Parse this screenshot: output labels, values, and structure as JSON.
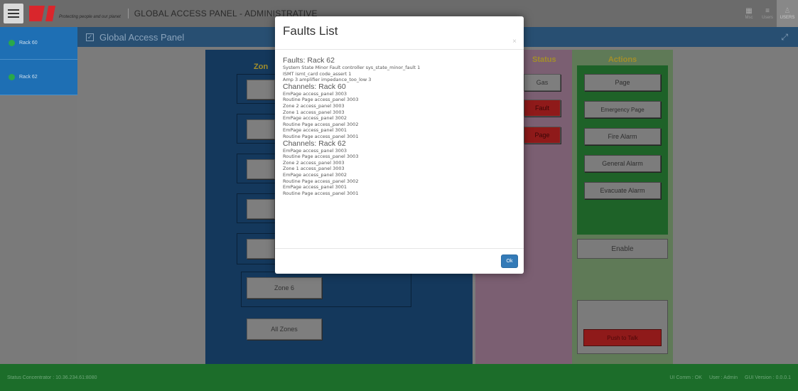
{
  "header": {
    "logo_tagline": "Protecting people and our planet",
    "app_title": "GLOBAL ACCESS PANEL - ADMINISTRATIVE",
    "buttons": [
      {
        "label": "Msc",
        "icon": "grid-icon"
      },
      {
        "label": "Users",
        "icon": "list-icon"
      },
      {
        "label": "USERS",
        "icon": "user-icon"
      }
    ]
  },
  "sidebar": {
    "items": [
      {
        "label": "Rack 60",
        "status_color": "#2aa84a"
      },
      {
        "label": "Rack 62",
        "status_color": "#2aa84a"
      }
    ]
  },
  "panel": {
    "title": "Global Access Panel"
  },
  "zones": {
    "title_partial": "Zon",
    "buttons": [
      "Zone 6",
      "All Zones"
    ]
  },
  "status": {
    "title": "Status",
    "buttons": [
      {
        "label": "Gas",
        "color": "#7e7e7e"
      },
      {
        "label": "Fault",
        "color": "#8f1a1a"
      },
      {
        "label": "Page",
        "color": "#8f1a1a"
      }
    ]
  },
  "actions": {
    "title": "Actions",
    "buttons": [
      "Page",
      "Emergency Page",
      "Fire Alarm",
      "General Alarm",
      "Evacuate Alarm"
    ],
    "enable_label": "Enable",
    "push_to_talk_label": "Push to Talk"
  },
  "statusbar": {
    "left": "Status Concentrator : 10.36.234.61:8080",
    "ui_comm": "UI Comm : OK",
    "user": "User : Admin",
    "gui_version": "GUI Version : 0.0.0.1"
  },
  "modal": {
    "title": "Faults List",
    "close_symbol": "×",
    "sections": [
      {
        "heading": "Faults: Rack 62",
        "lines": [
          "System State Minor Fault controller sys_state_minor_fault 1",
          "ISMT ismt_card code_assert 1",
          "Amp 3 amplifier impedance_too_low 3"
        ]
      },
      {
        "heading": "Channels: Rack 60",
        "lines": [
          "EmPage access_panel 3003",
          "Routine Page access_panel 3003",
          "Zone 2 access_panel 3003",
          "Zone 1 access_panel 3003",
          "EmPage access_panel 3002",
          "Routine Page access_panel 3002",
          "EmPage access_panel 3001",
          "Routine Page access_panel 3001"
        ]
      },
      {
        "heading": "Channels: Rack 62",
        "lines": [
          "EmPage access_panel 3003",
          "Routine Page access_panel 3003",
          "Zone 2 access_panel 3003",
          "Zone 1 access_panel 3003",
          "EmPage access_panel 3002",
          "Routine Page access_panel 3002",
          "EmPage access_panel 3001",
          "Routine Page access_panel 3001"
        ]
      }
    ],
    "ok_label": "Ok"
  }
}
